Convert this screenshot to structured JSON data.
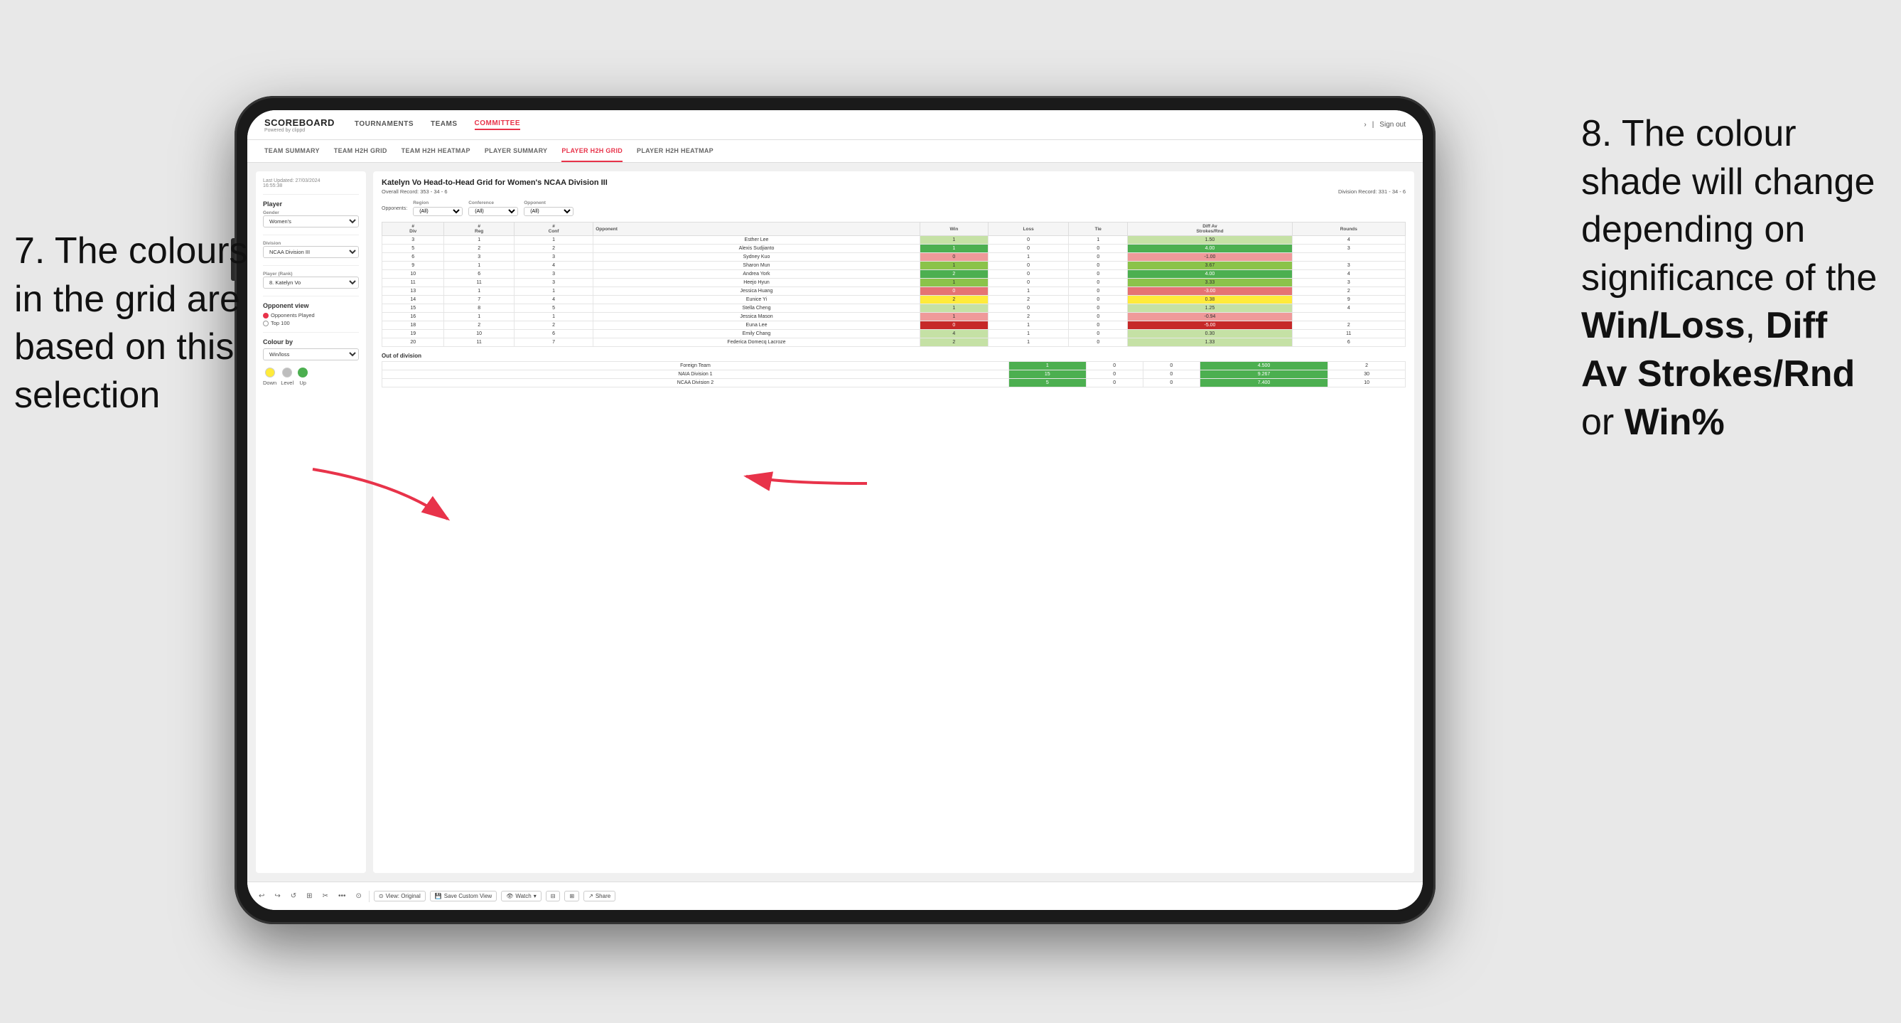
{
  "annotations": {
    "left": "7. The colours in the grid are based on this selection",
    "right_line1": "8. The colour shade will change depending on significance of the ",
    "right_bold1": "Win/Loss",
    "right_sep1": ", ",
    "right_bold2": "Diff Av Strokes/Rnd",
    "right_sep2": " or ",
    "right_bold3": "Win%"
  },
  "nav": {
    "logo": "SCOREBOARD",
    "powered": "Powered by clippd",
    "items": [
      "TOURNAMENTS",
      "TEAMS",
      "COMMITTEE"
    ],
    "active": "COMMITTEE",
    "right": [
      "Sign out"
    ]
  },
  "subnav": {
    "items": [
      "TEAM SUMMARY",
      "TEAM H2H GRID",
      "TEAM H2H HEATMAP",
      "PLAYER SUMMARY",
      "PLAYER H2H GRID",
      "PLAYER H2H HEATMAP"
    ],
    "active": "PLAYER H2H GRID"
  },
  "left_panel": {
    "last_updated_label": "Last Updated: 27/03/2024",
    "last_updated_time": "16:55:38",
    "player_section": "Player",
    "gender_label": "Gender",
    "gender_value": "Women's",
    "division_label": "Division",
    "division_value": "NCAA Division III",
    "player_rank_label": "Player (Rank)",
    "player_rank_value": "8. Katelyn Vo",
    "opponent_view_label": "Opponent view",
    "opponents_played": "Opponents Played",
    "top_100": "Top 100",
    "colour_by_label": "Colour by",
    "colour_by_value": "Win/loss",
    "legend_down": "Down",
    "legend_level": "Level",
    "legend_up": "Up"
  },
  "grid": {
    "title": "Katelyn Vo Head-to-Head Grid for Women's NCAA Division III",
    "overall_record_label": "Overall Record:",
    "overall_record": "353 - 34 - 6",
    "division_record_label": "Division Record:",
    "division_record": "331 - 34 - 6",
    "opponents_label": "Opponents:",
    "region_label": "Region",
    "conference_label": "Conference",
    "opponent_label": "Opponent",
    "filter_all": "(All)",
    "columns": [
      "#\nDiv",
      "#\nReg",
      "#\nConf",
      "Opponent",
      "Win",
      "Loss",
      "Tie",
      "Diff Av\nStrokes/Rnd",
      "Rounds"
    ],
    "rows": [
      {
        "div": 3,
        "reg": 1,
        "conf": 1,
        "opponent": "Esther Lee",
        "win": 1,
        "loss": 0,
        "tie": 1,
        "diff": 1.5,
        "rounds": 4,
        "color": "green-light"
      },
      {
        "div": 5,
        "reg": 2,
        "conf": 2,
        "opponent": "Alexis Sudjianto",
        "win": 1,
        "loss": 0,
        "tie": 0,
        "diff": 4.0,
        "rounds": 3,
        "color": "green-dark"
      },
      {
        "div": 6,
        "reg": 3,
        "conf": 3,
        "opponent": "Sydney Kuo",
        "win": 0,
        "loss": 1,
        "tie": 0,
        "diff": -1.0,
        "rounds": "",
        "color": "red-light"
      },
      {
        "div": 9,
        "reg": 1,
        "conf": 4,
        "opponent": "Sharon Mun",
        "win": 1,
        "loss": 0,
        "tie": 0,
        "diff": 3.67,
        "rounds": 3,
        "color": "green-med"
      },
      {
        "div": 10,
        "reg": 6,
        "conf": 3,
        "opponent": "Andrea York",
        "win": 2,
        "loss": 0,
        "tie": 0,
        "diff": 4.0,
        "rounds": 4,
        "color": "green-dark"
      },
      {
        "div": 11,
        "reg": 11,
        "conf": 3,
        "opponent": "Heejo Hyun",
        "win": 1,
        "loss": 0,
        "tie": 0,
        "diff": 3.33,
        "rounds": 3,
        "color": "green-med"
      },
      {
        "div": 13,
        "reg": 1,
        "conf": 1,
        "opponent": "Jessica Huang",
        "win": 0,
        "loss": 1,
        "tie": 0,
        "diff": -3.0,
        "rounds": 2,
        "color": "red-med"
      },
      {
        "div": 14,
        "reg": 7,
        "conf": 4,
        "opponent": "Eunice Yi",
        "win": 2,
        "loss": 2,
        "tie": 0,
        "diff": 0.38,
        "rounds": 9,
        "color": "yellow"
      },
      {
        "div": 15,
        "reg": 8,
        "conf": 5,
        "opponent": "Stella Cheng",
        "win": 1,
        "loss": 0,
        "tie": 0,
        "diff": 1.25,
        "rounds": 4,
        "color": "green-light"
      },
      {
        "div": 16,
        "reg": 1,
        "conf": 1,
        "opponent": "Jessica Mason",
        "win": 1,
        "loss": 2,
        "tie": 0,
        "diff": -0.94,
        "rounds": "",
        "color": "red-light"
      },
      {
        "div": 18,
        "reg": 2,
        "conf": 2,
        "opponent": "Euna Lee",
        "win": 0,
        "loss": 1,
        "tie": 0,
        "diff": -5.0,
        "rounds": 2,
        "color": "red-dark"
      },
      {
        "div": 19,
        "reg": 10,
        "conf": 6,
        "opponent": "Emily Chang",
        "win": 4,
        "loss": 1,
        "tie": 0,
        "diff": 0.3,
        "rounds": 11,
        "color": "green-light"
      },
      {
        "div": 20,
        "reg": 11,
        "conf": 7,
        "opponent": "Federica Domecq Lacroze",
        "win": 2,
        "loss": 1,
        "tie": 0,
        "diff": 1.33,
        "rounds": 6,
        "color": "green-light"
      }
    ],
    "out_of_division_label": "Out of division",
    "ood_rows": [
      {
        "name": "Foreign Team",
        "win": 1,
        "loss": 0,
        "tie": 0,
        "diff": 4.5,
        "rounds": 2,
        "color": "green-dark"
      },
      {
        "name": "NAIA Division 1",
        "win": 15,
        "loss": 0,
        "tie": 0,
        "diff": 9.267,
        "rounds": 30,
        "color": "green-dark"
      },
      {
        "name": "NCAA Division 2",
        "win": 5,
        "loss": 0,
        "tie": 0,
        "diff": 7.4,
        "rounds": 10,
        "color": "green-dark"
      }
    ]
  },
  "toolbar": {
    "buttons": [
      "↩",
      "↪",
      "⟲",
      "⊞",
      "✂",
      "·",
      "⊙"
    ],
    "view_original": "View: Original",
    "save_custom_view": "Save Custom View",
    "watch": "Watch",
    "share": "Share"
  },
  "colors": {
    "accent": "#e8334a",
    "green_dark": "#4caf50",
    "green_med": "#8bc34a",
    "green_light": "#c5e1a5",
    "yellow": "#ffeb3b",
    "red_light": "#ef9a9a",
    "red_med": "#e57373",
    "red_dark": "#c62828"
  }
}
